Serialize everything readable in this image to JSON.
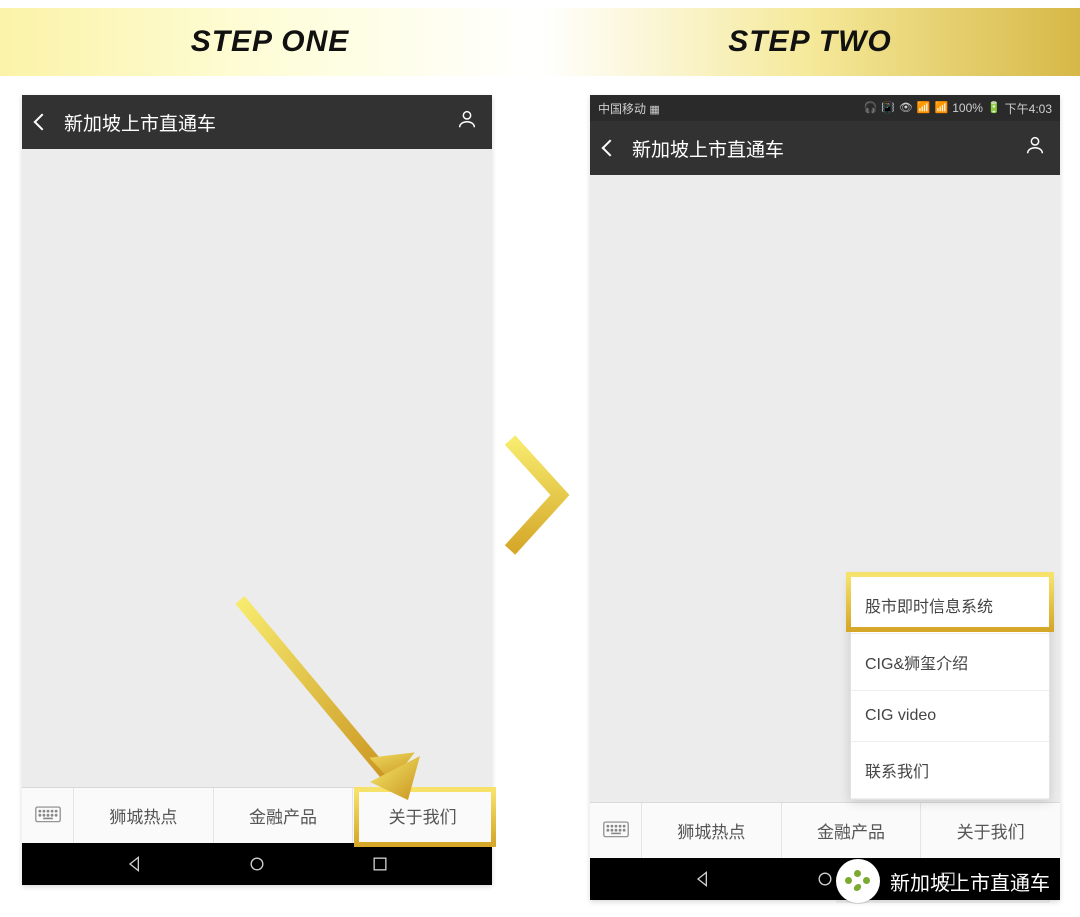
{
  "header": {
    "step1": "STEP ONE",
    "step2": "STEP TWO"
  },
  "status": {
    "carrier": "中国移动",
    "battery": "100%",
    "time": "下午4:03"
  },
  "title": "新加坡上市直通车",
  "tabs": {
    "t1": "狮城热点",
    "t2": "金融产品",
    "t3": "关于我们"
  },
  "submenu": {
    "i1": "股市即时信息系统",
    "i2": "CIG&狮玺介绍",
    "i3": "CIG video",
    "i4": "联系我们"
  },
  "watermark": {
    "text": "新加坡上市直通车"
  }
}
